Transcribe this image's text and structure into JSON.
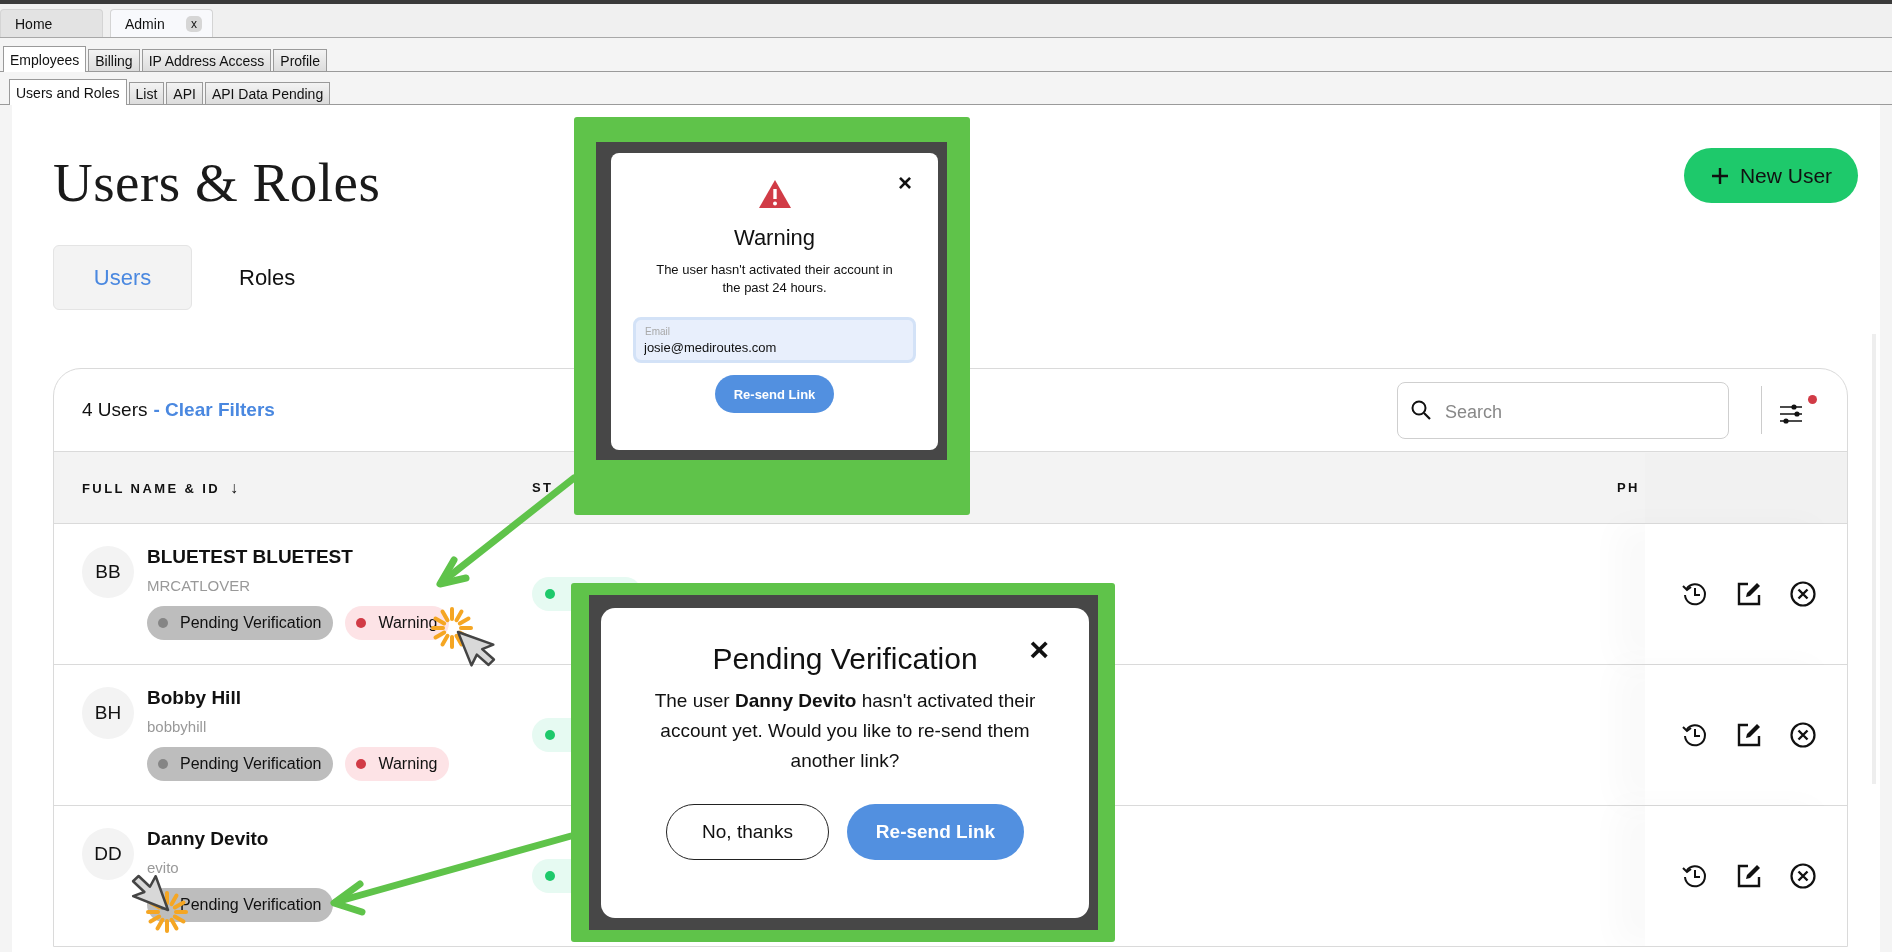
{
  "browser_tabs": [
    {
      "label": "Home",
      "selected": false
    },
    {
      "label": "Admin",
      "selected": true,
      "close": "x"
    }
  ],
  "section_tabs": [
    {
      "label": "Employees",
      "selected": true
    },
    {
      "label": "Billing",
      "selected": false
    },
    {
      "label": "IP Address Access",
      "selected": false
    },
    {
      "label": "Profile",
      "selected": false
    }
  ],
  "sub_tabs": [
    {
      "label": "Users and Roles",
      "selected": true
    },
    {
      "label": "List",
      "selected": false
    },
    {
      "label": "API",
      "selected": false
    },
    {
      "label": "API Data Pending",
      "selected": false
    }
  ],
  "page": {
    "title": "Users & Roles",
    "new_user_button": "New User"
  },
  "view_tabs": [
    {
      "label": "Users",
      "selected": true
    },
    {
      "label": "Roles",
      "selected": false
    }
  ],
  "table": {
    "count": "4 Users",
    "clear_filters": "- Clear Filters",
    "search": {
      "placeholder": "Search"
    },
    "filters_active": true,
    "columns": [
      {
        "label": "FULL NAME & ID",
        "sort": "↓"
      },
      {
        "label": "ST"
      },
      {
        "label": "PH"
      }
    ],
    "rows": [
      {
        "initials": "BB",
        "name": "BLUETEST BLUETEST",
        "username": "MRCATLOVER",
        "tags": [
          {
            "label": "Pending Verification",
            "kind": "pending"
          },
          {
            "label": "Warning",
            "kind": "warning"
          }
        ]
      },
      {
        "initials": "BH",
        "name": "Bobby Hill",
        "username": "bobbyhill",
        "tags": [
          {
            "label": "Pending Verification",
            "kind": "pending"
          },
          {
            "label": "Warning",
            "kind": "warning"
          }
        ]
      },
      {
        "initials": "DD",
        "name": "Danny Devito",
        "username": "evito",
        "tags": [
          {
            "label": "Pending Verification",
            "kind": "pending"
          }
        ]
      }
    ]
  },
  "callouts": [
    {
      "kind": "warning",
      "title": "Warning",
      "close": "×",
      "message": "The user hasn't activated their account in the past 24 hours.",
      "email": {
        "label": "Email",
        "value": "josie@mediroutes.com"
      },
      "buttons": [
        {
          "label": "Re-send Link",
          "kind": "primary"
        }
      ]
    },
    {
      "kind": "pending",
      "title": "Pending Verification",
      "close": "×",
      "message": "The user **Danny Devito** hasn't activated their account yet. Would you like to re-send them another link?",
      "buttons": [
        {
          "label": "No, thanks",
          "kind": "secondary"
        },
        {
          "label": "Re-send Link",
          "kind": "primary"
        }
      ]
    }
  ]
}
